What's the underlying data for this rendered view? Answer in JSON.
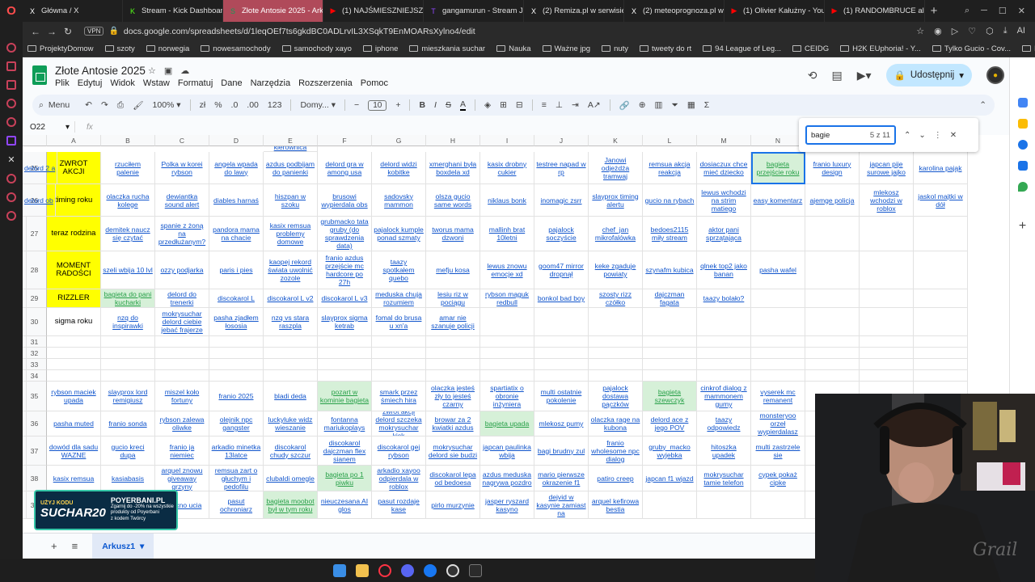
{
  "browser": {
    "tabs": [
      {
        "label": "Główna / X",
        "icon": "X"
      },
      {
        "label": "Stream - Kick Dashboard",
        "icon": "K"
      },
      {
        "label": "Złote Antosie 2025 - Arku",
        "icon": "S",
        "active": true
      },
      {
        "label": "(1) NAJŚMIESZNIEJSZE M",
        "icon": "▶"
      },
      {
        "label": "gangamurun - Stream Ja",
        "icon": "T"
      },
      {
        "label": "(2) Remiza.pl w serwisie",
        "icon": "X"
      },
      {
        "label": "(2) meteoprognoza.pl w",
        "icon": "X"
      },
      {
        "label": "(1) Olivier Kałużny - YouT",
        "icon": "▶"
      },
      {
        "label": "(1) RANDOMBRUCE ale to",
        "icon": "▶"
      }
    ],
    "new_tab": "+",
    "vpn": "VPN",
    "url": "docs.google.com/spreadsheets/d/1leqOEf7ts6gkdBC0ADLrvIL3XSqkT9EnMOARsXylno4/edit",
    "ai_label": "AI",
    "bookmarks": [
      "ProjektyDomow",
      "szoty",
      "norwegia",
      "nowesamochody",
      "samochody xayo",
      "iphone",
      "mieszkania suchar",
      "Nauka",
      "Ważne jpg",
      "nuty",
      "tweety do rt",
      "94 League of Leg...",
      "CEIDG",
      "H2K EUphoria! - Y...",
      "Tylko Gucio - Cov...",
      "Imgur: The most a..."
    ]
  },
  "sheets": {
    "title": "Złote Antosie 2025",
    "menu": [
      "Plik",
      "Edytuj",
      "Widok",
      "Wstaw",
      "Formatuj",
      "Dane",
      "Narzędzia",
      "Rozszerzenia",
      "Pomoc"
    ],
    "share_label": "Udostępnij",
    "toolbar": {
      "menu_label": "Menu",
      "zoom": "100%",
      "currency": "zł",
      "percent": "%",
      "dec_dec": ".0",
      "dec_inc": ".00",
      "num_fmt": "123",
      "font": "Domy...",
      "font_size": "10"
    },
    "cell_ref": "O22",
    "fx": "fx",
    "find": {
      "query": "bagie",
      "count": "5 z 11"
    },
    "sheet_tab": "Arkusz1",
    "col_headers": [
      "A",
      "B",
      "C",
      "D",
      "E",
      "F",
      "G",
      "H",
      "I",
      "J",
      "K",
      "L",
      "M",
      "N",
      "O",
      "P",
      "Q"
    ],
    "top_row_partial": "kierownica",
    "rows": [
      {
        "num": "25",
        "cells": [
          "ZWROT AKCJI",
          "rzuciłem palenie",
          "Polka w korei rybson",
          "angela wpada do lawy",
          "azdus podbijam do panienki",
          "delord gra w among usa",
          "delord widzi kobitke",
          "xmerghani była boxdela xd",
          "kasix drobny cukier",
          "testree napad w rp",
          "Janowi odjeżdża tramwaj",
          "remsua akcja reakcja",
          "dosiaczux chce mieć dziecko",
          "bagieta przejście roku",
          "franio luxury design",
          "japcan pije surowe jajko",
          "karolina pająk",
          "delord 2 a"
        ]
      },
      {
        "num": "26",
        "cells": [
          "timing roku",
          "olaczka rucha kolege",
          "dewiantka sound alert",
          "diables harnaś",
          "hiszpan w szoku",
          "brusowi wypierdala obs",
          "sadovsky mammon",
          "olsza gucio same words",
          "niklaus bonk",
          "inomagic zsrr",
          "slayprox timing alertu",
          "gucio na rybach",
          "lewus wchodzi na strim matiego",
          "easy komentarz",
          "ajemge policja",
          "mlekosz wchodzi w roblox",
          "jaskol majtki w dół",
          "delord ob"
        ]
      },
      {
        "num": "27",
        "cells": [
          "teraz rodzina",
          "demitek naucz się czytać",
          "spanie z żoną na przedłużanym?",
          "pandora mama na chacie",
          "kasix remsua problemy domowe",
          "grubmacko tata gruby (do sprawdzenia data)",
          "pajalock kumple ponad szmaty",
          "tworus mama dzwoni",
          "mallinh brat 10letni",
          "pajalock soczyście",
          "chef_jan mikrofalówka",
          "bedoes2115 miły stream",
          "aktor pani sprzątająca",
          "",
          "",
          "",
          "",
          ""
        ]
      },
      {
        "num": "28",
        "cells": [
          "MOMENT RADOŚCI",
          "szeli wbija 10 lvl",
          "ozzy podjarka",
          "paris i pies",
          "kaopej rekord świata uwolnić zozole",
          "franio azdus przejście mc hardcore po 27h",
          "taazy spotkałem quebo",
          "mefju kosa",
          "lewus znowu emocje xd",
          "goom47 mirror dropnął",
          "keke zgaduje powiaty",
          "szynafm kubica",
          "qlnek top2 jako banan",
          "pasha wafel",
          "",
          "",
          "",
          ""
        ]
      },
      {
        "num": "29",
        "cells": [
          "RIZZLER",
          "bagieta do pani kucharki",
          "delord do trenerki",
          "discokarol L",
          "discokarol L v2",
          "discokarol L v3",
          "meduska chuja rozumiem",
          "lesiu riz w pociągu",
          "rybson mąguk redbull",
          "bonkol bad boy",
          "szosty rizz czółko",
          "dajczman fagata",
          "taazy bolało?",
          "",
          "",
          "",
          "",
          ""
        ]
      },
      {
        "num": "30",
        "cells": [
          "sigma roku",
          "nzq do inspirawki",
          "mokrysuchar delord ciebie jebać frajerze",
          "pasha zjadłem łososia",
          "nzq vs stara raszpla",
          "slayprox sigma ketrab",
          "fomal do brusa u xn'a",
          "amar nie szanuje policji",
          "",
          "",
          "",
          "",
          "",
          "",
          "",
          "",
          "",
          ""
        ]
      },
      {
        "num": "31",
        "cells": [
          "",
          "",
          "",
          "",
          "",
          "",
          "",
          "",
          "",
          "",
          "",
          "",
          "",
          "",
          "",
          "",
          "",
          ""
        ]
      },
      {
        "num": "32",
        "cells": [
          "",
          "",
          "",
          "",
          "",
          "",
          "",
          "",
          "",
          "",
          "",
          "",
          "",
          "",
          "",
          "",
          "",
          ""
        ]
      },
      {
        "num": "33",
        "cells": [
          "",
          "",
          "",
          "",
          "",
          "",
          "",
          "",
          "",
          "",
          "",
          "",
          "",
          "",
          "",
          "",
          "",
          ""
        ]
      },
      {
        "num": "34",
        "cells": [
          "",
          "",
          "",
          "",
          "",
          "",
          "",
          "",
          "",
          "",
          "",
          "",
          "",
          "",
          "",
          "",
          "",
          ""
        ]
      },
      {
        "num": "35",
        "cells": [
          "rybson maciek upada",
          "slayprox lord remigiusz",
          "miszel koło fortuny",
          "franio 2025",
          "bladi deda",
          "pozart w kominie bagieta",
          "smark przez śmiech hira",
          "olaczka jesteś zły to jesteś czarny",
          "spartiatix o obronie inżyniera",
          "multi ostatnie pokolenie",
          "pajalock dostawa pączków",
          "bagieta szewczyk",
          "cinkrof dialog z mammonem gumy",
          "vyserek mc remanent",
          "",
          "",
          "",
          ""
        ]
      },
      {
        "num": "36",
        "cells": [
          "pasha muted",
          "franio sonda",
          "rybson zalewa oliwke",
          "olejnik npc gangster",
          "luckyluke widz wieszanie",
          "fontanna mariukoplays",
          "zwrot akcji delord szczeka mokrysuchar kick",
          "browar za 2 kwiatki azdus",
          "bagieta upada",
          "mlekosz pumy",
          "olaczka rage na kubona",
          "delord ace z jego POV",
          "taazy odpowiedz",
          "monsteryoo orzeł wypierdalasz",
          "",
          "",
          "",
          ""
        ]
      },
      {
        "num": "37",
        "cells": [
          "dowód dla sadu WAZNE",
          "gucio kreci dupa",
          "franio ja niemiec",
          "arkadio minetka 13latce",
          "discokarol chudy szczur",
          "discokarol dajczman flex sianem",
          "discokarol gej rybson",
          "mokrysuchar delord sie budzi",
          "japcan paulinka wbija",
          "bagi brudny zul",
          "franio wholesome npc dialog",
          "gruby_macko wyjebka",
          "hitoszka upadek",
          "multi zastrzele sie",
          "",
          "",
          "",
          ""
        ]
      },
      {
        "num": "38",
        "cells": [
          "kasix remsua",
          "kasiabasis",
          "arquel znowu giveaway grzyny",
          "remsua zart o głuchym i pedofilu",
          "clubaldi omegle",
          "bagieta po 1 piwku",
          "arkadio xayoo odpierdala w roblox",
          "discokarol lepa od bedoesa",
          "azdus meduska nagrywa pozdro",
          "mario pierwsze okrazenie f1",
          "patiro creep",
          "japcan f1 wjazd",
          "mokrysuchar tamie telefon",
          "cypek pokaż cipke",
          "",
          "",
          "",
          ""
        ]
      },
      {
        "num": "39",
        "cells": [
          "",
          "",
          "rol okno ucia",
          "pasut ochroniarz",
          "bagieta moobot był w tym roku",
          "nieuczesana AI glos",
          "pasut rozdaje kase",
          "pirlo murzynie",
          "jasper ryszard kasyno",
          "dejvid w kasynie zamiast na",
          "arquel kefirowa bestia",
          "",
          "",
          "",
          "",
          "",
          "",
          ""
        ]
      }
    ]
  },
  "sponsor": {
    "top": "UŻYJ KODU",
    "code": "SUCHAR20",
    "brand": "POYERBANI.PL",
    "line1": "Zgarnij do -20% na wszystkie",
    "line2": "produkty od Poyerbani",
    "line3": "z kodem Twórcy"
  }
}
